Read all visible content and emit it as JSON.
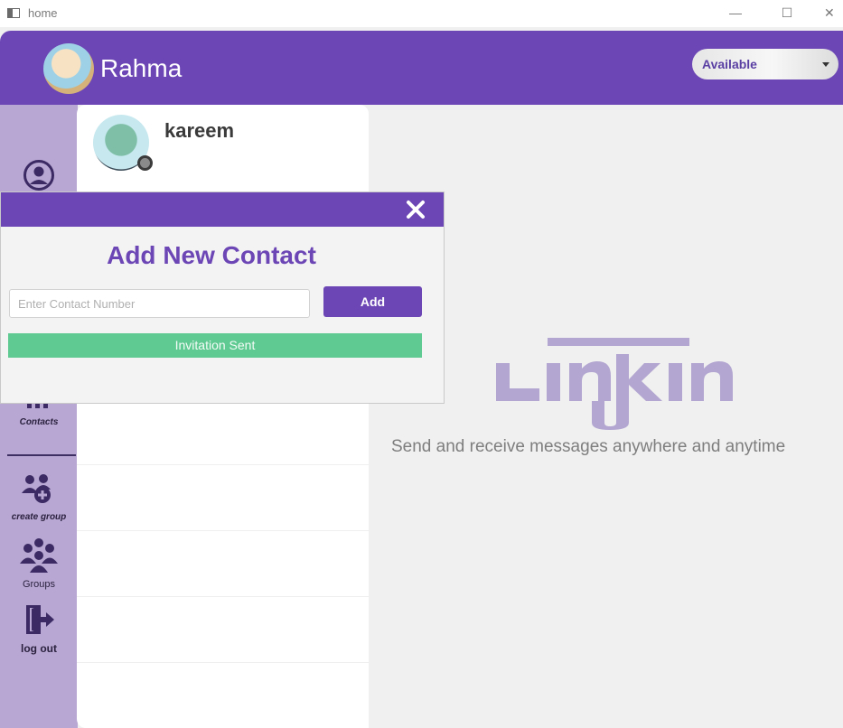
{
  "window": {
    "title": "home",
    "minimize": "—",
    "maximize": "☐",
    "close": "✕"
  },
  "header": {
    "username": "Rahma",
    "status": {
      "selected": "Available"
    }
  },
  "sidebar": {
    "items": [
      {
        "label": "",
        "icon": "user-circle-icon"
      },
      {
        "label": "Contacts",
        "icon": "contacts-icon"
      },
      {
        "label": "create group",
        "icon": "create-group-icon"
      },
      {
        "label": "Groups",
        "icon": "groups-icon"
      },
      {
        "label": "log out",
        "icon": "logout-icon"
      }
    ]
  },
  "contacts": [
    {
      "name": "kareem",
      "status_color": "#8a8a8a"
    }
  ],
  "main": {
    "logo_text": "LINKIN",
    "tagline": "Send and receive messages anywhere and anytime"
  },
  "dialog": {
    "title": "Add New Contact",
    "input_placeholder": "Enter Contact Number",
    "input_value": "",
    "add_label": "Add",
    "banner": "Invitation Sent"
  },
  "colors": {
    "brand": "#6c46b5",
    "sidebar": "#b7a7d2",
    "success": "#5fcb92",
    "logo": "#b3a7d1"
  }
}
